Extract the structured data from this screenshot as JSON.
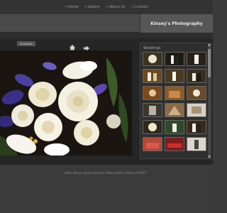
{
  "nav": {
    "items": [
      "» Home",
      "» Gallery",
      "» About Us",
      "» Contact"
    ]
  },
  "header": {
    "title": "Kinsey's Photography"
  },
  "toolbar": {
    "slideshow_label": "Slideshow"
  },
  "sidebar": {
    "gallery_title": "Weddings"
  },
  "footer": {
    "text": "Web album generated by Web Gallery Wizard PRO™"
  },
  "colors": {
    "background": "#3a3a3a",
    "panel": "#262626",
    "accent": "#e8e8e8"
  }
}
